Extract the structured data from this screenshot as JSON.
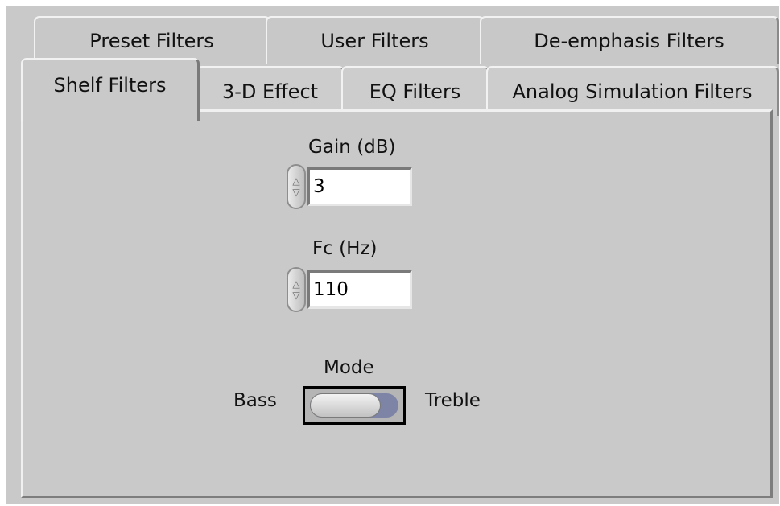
{
  "tabs": {
    "row_back": [
      "Preset Filters",
      "User Filters",
      "De-emphasis Filters"
    ],
    "row_front": [
      "Shelf Filters",
      "3-D Effect",
      "EQ Filters",
      "Analog Simulation Filters"
    ],
    "active": "Shelf Filters"
  },
  "gain": {
    "label": "Gain (dB)",
    "value": "3"
  },
  "fc": {
    "label": "Fc (Hz)",
    "value": "110"
  },
  "mode": {
    "label": "Mode",
    "left": "Bass",
    "right": "Treble",
    "state": "Bass"
  }
}
